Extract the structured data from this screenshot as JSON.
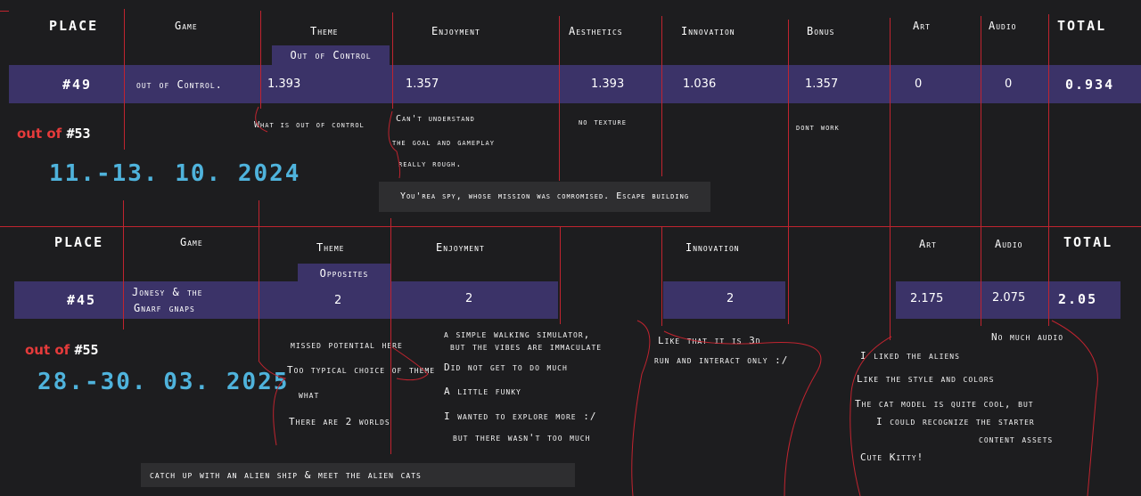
{
  "entry1": {
    "headers": {
      "place": "PLACE",
      "game": "Game",
      "theme": "Theme",
      "enjoyment": "Enjoyment",
      "aesthetics": "Aesthetics",
      "innovation": "Innovation",
      "bonus": "Bonus",
      "art": "Art",
      "audio": "Audio",
      "total": "TOTAL"
    },
    "theme_name": "Out of Control",
    "row": {
      "place": "#49",
      "game": "out of Control.",
      "theme": "1.393",
      "enjoyment": "1.357",
      "aesthetics": "1.393",
      "innovation": "1.036",
      "bonus": "1.357",
      "art": "0",
      "audio": "0",
      "total": "0.934"
    },
    "out_of_label": "out of",
    "out_of_count": "#53",
    "date": "11.-13. 10. 2024",
    "comments": {
      "theme": [
        "What is out of control"
      ],
      "enjoyment": [
        "Can't understand",
        "the goal and gameplay",
        "really rough."
      ],
      "aesthetics": [
        "no texture"
      ],
      "bonus": [
        "dont work"
      ]
    },
    "description": "You'rea spy, whose mission was comromised. Escape building"
  },
  "entry2": {
    "headers": {
      "place": "PLACE",
      "game": "Game",
      "theme": "Theme",
      "enjoyment": "Enjoyment",
      "innovation": "Innovation",
      "art": "Art",
      "audio": "Audio",
      "total": "TOTAL"
    },
    "theme_name": "Opposites",
    "row": {
      "place": "#45",
      "game_line1": "Jonesy & the",
      "game_line2": "Gnarf gnaps",
      "theme": "2",
      "enjoyment": "2",
      "innovation": "2",
      "art": "2.175",
      "audio": "2.075",
      "total": "2.05"
    },
    "out_of_label": "out of",
    "out_of_count": "#55",
    "date": "28.-30. 03. 2025",
    "comments": {
      "theme": [
        "missed potential here",
        "Too typical choice of theme",
        "what",
        "There are 2 worlds"
      ],
      "enjoyment": [
        "a simple walking simulator,",
        "but the vibes are immaculate",
        "Did not get to do much",
        "A little funky",
        "I wanted to explore more :/",
        "but there wasn't too much"
      ],
      "innovation": [
        "Like that it is 3d",
        "run and interact only :/"
      ],
      "audio": [
        "No much audio"
      ],
      "art": [
        "I liked the aliens",
        "Like the style and colors",
        "The cat model is quite cool, but",
        "I could recognize the starter",
        "content assets",
        "Cute Kitty!"
      ]
    },
    "description": "catch up with an alien ship & meet the alien cats"
  }
}
